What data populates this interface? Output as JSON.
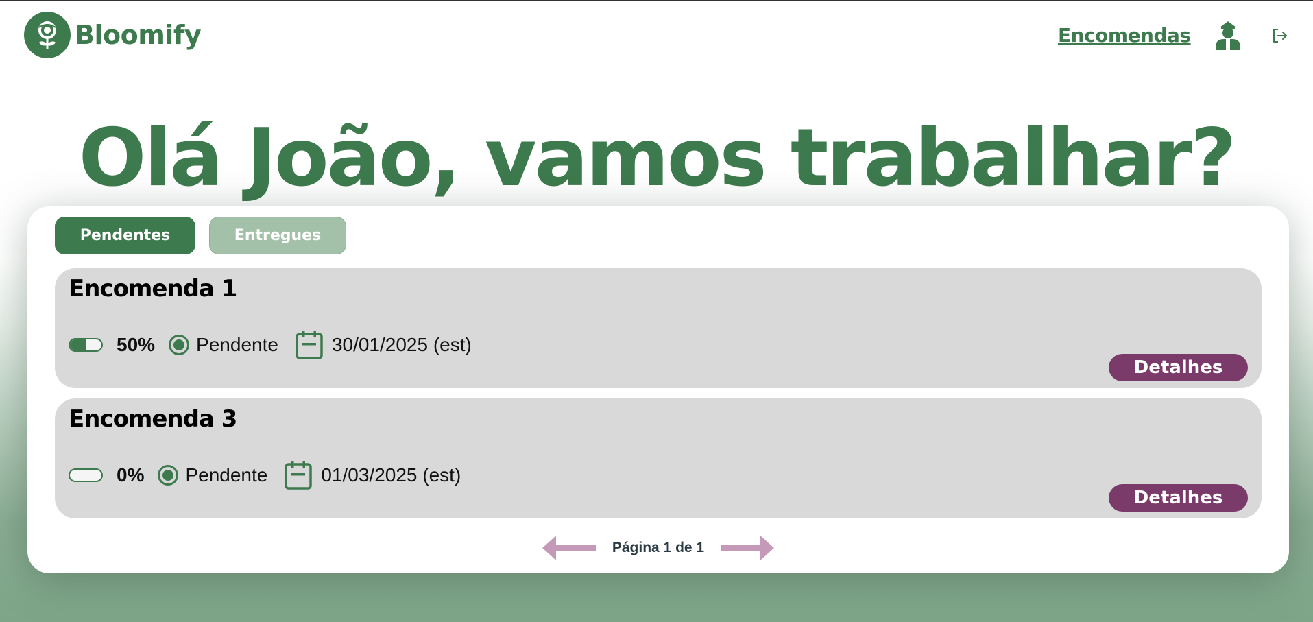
{
  "brand": {
    "name": "Bloomify"
  },
  "nav": {
    "orders_link": "Encomendas"
  },
  "hero": {
    "greeting": "Olá João, vamos trabalhar?"
  },
  "tabs": [
    {
      "label": "Pendentes",
      "active": true
    },
    {
      "label": "Entregues",
      "active": false
    }
  ],
  "orders": [
    {
      "title": "Encomenda 1",
      "progress_text": "50%",
      "progress": 0.5,
      "status": "Pendente",
      "date": "30/01/2025 (est)",
      "details_label": "Detalhes"
    },
    {
      "title": "Encomenda 3",
      "progress_text": "0%",
      "progress": 0.0,
      "status": "Pendente",
      "date": "01/03/2025 (est)",
      "details_label": "Detalhes"
    }
  ],
  "pagination": {
    "text": "Página 1 de 1"
  },
  "colors": {
    "primary": "#3d7a4d",
    "accent": "#7a3a6a",
    "arrow": "#c49ab8",
    "card": "#d9d9d9"
  }
}
